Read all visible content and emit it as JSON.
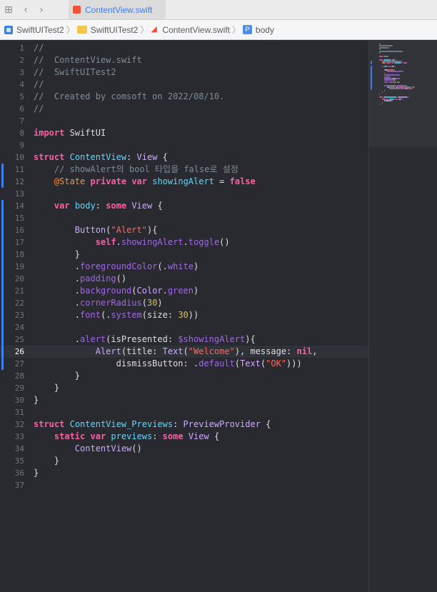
{
  "tab": {
    "title": "ContentView.swift"
  },
  "jumpbar": {
    "project": "SwiftUITest2",
    "folder": "SwiftUITest2",
    "file": "ContentView.swift",
    "symbol_badge": "P",
    "symbol": "body"
  },
  "editor": {
    "current_line": 26,
    "changed_ranges": [
      [
        11,
        12
      ],
      [
        14,
        27
      ]
    ],
    "lines": [
      [
        [
          "c",
          "//"
        ]
      ],
      [
        [
          "c",
          "//  ContentView.swift"
        ]
      ],
      [
        [
          "c",
          "//  SwiftUITest2"
        ]
      ],
      [
        [
          "c",
          "//"
        ]
      ],
      [
        [
          "c",
          "//  Created by comsoft on 2022/08/10."
        ]
      ],
      [
        [
          "c",
          "//"
        ]
      ],
      [],
      [
        [
          "k",
          "import"
        ],
        [
          "p",
          " SwiftUI"
        ]
      ],
      [],
      [
        [
          "k",
          "struct"
        ],
        [
          "p",
          " "
        ],
        [
          "d",
          "ContentView"
        ],
        [
          "p",
          ": "
        ],
        [
          "t",
          "View"
        ],
        [
          "p",
          " {"
        ]
      ],
      [
        [
          "p",
          "    "
        ],
        [
          "c",
          "// showAlert의 bool 타입을 false로 설정"
        ]
      ],
      [
        [
          "p",
          "    "
        ],
        [
          "a",
          "@State"
        ],
        [
          "p",
          " "
        ],
        [
          "k",
          "private"
        ],
        [
          "p",
          " "
        ],
        [
          "k",
          "var"
        ],
        [
          "p",
          " "
        ],
        [
          "d",
          "showingAlert"
        ],
        [
          "p",
          " = "
        ],
        [
          "k",
          "false"
        ]
      ],
      [],
      [
        [
          "p",
          "    "
        ],
        [
          "k",
          "var"
        ],
        [
          "p",
          " "
        ],
        [
          "d",
          "body"
        ],
        [
          "p",
          ": "
        ],
        [
          "k",
          "some"
        ],
        [
          "p",
          " "
        ],
        [
          "t",
          "View"
        ],
        [
          "p",
          " {"
        ]
      ],
      [],
      [
        [
          "p",
          "        "
        ],
        [
          "t",
          "Button"
        ],
        [
          "p",
          "("
        ],
        [
          "s",
          "\"Alert\""
        ],
        [
          "p",
          "){"
        ]
      ],
      [
        [
          "p",
          "            "
        ],
        [
          "k",
          "self"
        ],
        [
          "p",
          "."
        ],
        [
          "m",
          "showingAlert"
        ],
        [
          "p",
          "."
        ],
        [
          "m",
          "toggle"
        ],
        [
          "p",
          "()"
        ]
      ],
      [
        [
          "p",
          "        }"
        ]
      ],
      [
        [
          "p",
          "        ."
        ],
        [
          "m",
          "foregroundColor"
        ],
        [
          "p",
          "(."
        ],
        [
          "m",
          "white"
        ],
        [
          "p",
          ")"
        ]
      ],
      [
        [
          "p",
          "        ."
        ],
        [
          "m",
          "padding"
        ],
        [
          "p",
          "()"
        ]
      ],
      [
        [
          "p",
          "        ."
        ],
        [
          "m",
          "background"
        ],
        [
          "p",
          "("
        ],
        [
          "t",
          "Color"
        ],
        [
          "p",
          "."
        ],
        [
          "m",
          "green"
        ],
        [
          "p",
          ")"
        ]
      ],
      [
        [
          "p",
          "        ."
        ],
        [
          "m",
          "cornerRadius"
        ],
        [
          "p",
          "("
        ],
        [
          "n",
          "30"
        ],
        [
          "p",
          ")"
        ]
      ],
      [
        [
          "p",
          "        ."
        ],
        [
          "m",
          "font"
        ],
        [
          "p",
          "(."
        ],
        [
          "m",
          "system"
        ],
        [
          "p",
          "(size: "
        ],
        [
          "n",
          "30"
        ],
        [
          "p",
          "))"
        ]
      ],
      [],
      [
        [
          "p",
          "        ."
        ],
        [
          "m",
          "alert"
        ],
        [
          "p",
          "(isPresented: "
        ],
        [
          "m",
          "$showingAlert"
        ],
        [
          "p",
          "){"
        ]
      ],
      [
        [
          "p",
          "            "
        ],
        [
          "t",
          "Alert"
        ],
        [
          "p",
          "(title: "
        ],
        [
          "t",
          "Text"
        ],
        [
          "p",
          "("
        ],
        [
          "s",
          "\"Welcome\""
        ],
        [
          "p",
          "), message: "
        ],
        [
          "k",
          "nil"
        ],
        [
          "p",
          ","
        ]
      ],
      [
        [
          "p",
          "                dismissButton: ."
        ],
        [
          "m",
          "default"
        ],
        [
          "p",
          "("
        ],
        [
          "t",
          "Text"
        ],
        [
          "p",
          "("
        ],
        [
          "s",
          "\"OK\""
        ],
        [
          "p",
          ")))"
        ]
      ],
      [
        [
          "p",
          "        }"
        ]
      ],
      [
        [
          "p",
          "    }"
        ]
      ],
      [
        [
          "p",
          "}"
        ]
      ],
      [],
      [
        [
          "k",
          "struct"
        ],
        [
          "p",
          " "
        ],
        [
          "d",
          "ContentView_Previews"
        ],
        [
          "p",
          ": "
        ],
        [
          "t",
          "PreviewProvider"
        ],
        [
          "p",
          " {"
        ]
      ],
      [
        [
          "p",
          "    "
        ],
        [
          "k",
          "static"
        ],
        [
          "p",
          " "
        ],
        [
          "k",
          "var"
        ],
        [
          "p",
          " "
        ],
        [
          "d",
          "previews"
        ],
        [
          "p",
          ": "
        ],
        [
          "k",
          "some"
        ],
        [
          "p",
          " "
        ],
        [
          "t",
          "View"
        ],
        [
          "p",
          " {"
        ]
      ],
      [
        [
          "p",
          "        "
        ],
        [
          "t",
          "ContentView"
        ],
        [
          "p",
          "()"
        ]
      ],
      [
        [
          "p",
          "    }"
        ]
      ],
      [
        [
          "p",
          "}"
        ]
      ],
      []
    ]
  },
  "syntax_colors": {
    "comment": "#7f8c98",
    "keyword": "#fc5fa3",
    "type": "#d0a8ff",
    "declaration": "#5dd8ff",
    "member": "#a167e6",
    "string": "#fc6a5d",
    "number": "#d0bf69",
    "attribute": "#fd8f3f",
    "plain": "#dfdfe0",
    "change_bar": "#3e7ff0",
    "background": "#292a30"
  }
}
